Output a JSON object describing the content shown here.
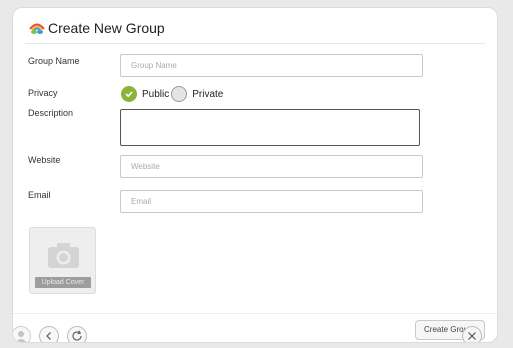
{
  "header": {
    "title": "Create New Group"
  },
  "form": {
    "group_name": {
      "label": "Group Name",
      "placeholder": "Group Name",
      "value": ""
    },
    "privacy": {
      "label": "Privacy",
      "options": [
        "Public",
        "Private"
      ],
      "selected": "Public"
    },
    "description": {
      "label": "Description",
      "value": ""
    },
    "website": {
      "label": "Website",
      "placeholder": "Website",
      "value": ""
    },
    "email": {
      "label": "Email",
      "placeholder": "Email",
      "value": ""
    }
  },
  "cover": {
    "label": "Upload Cover"
  },
  "footer": {
    "create_label": "Create Group"
  },
  "colors": {
    "accent_green": "#8ab43a",
    "border": "#c9c9c9"
  }
}
